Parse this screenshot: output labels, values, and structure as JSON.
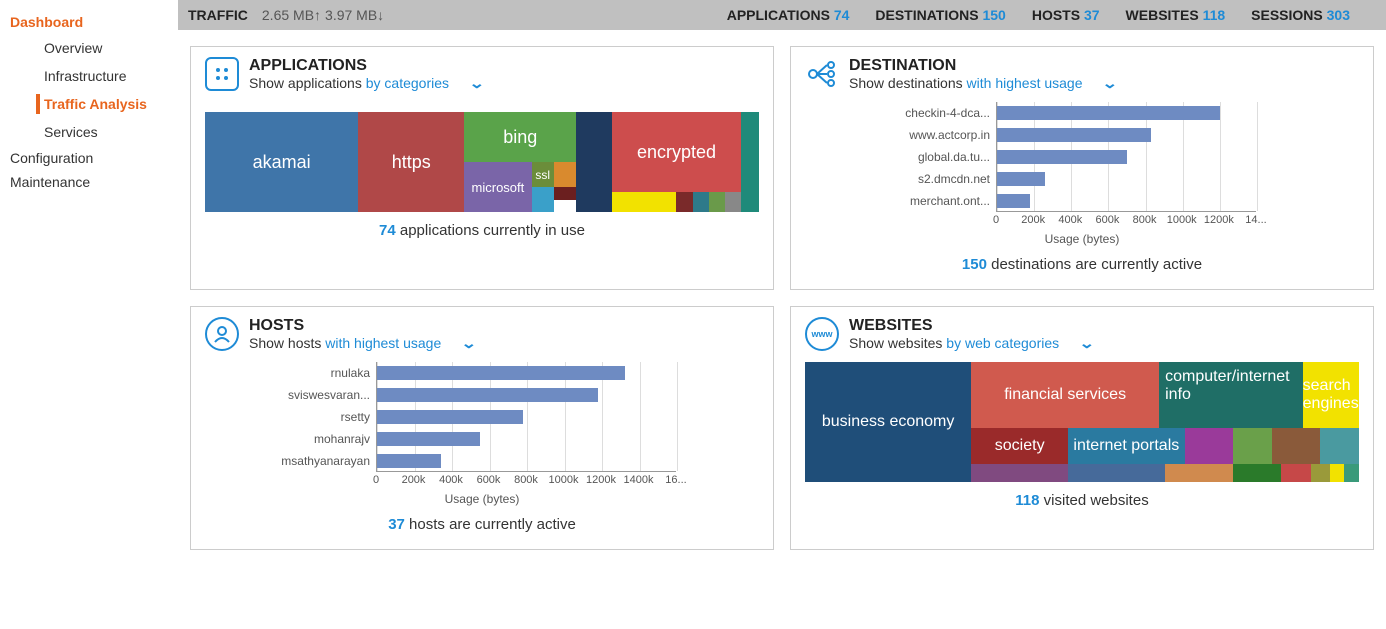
{
  "sidebar": {
    "dashboard": "Dashboard",
    "items": [
      {
        "label": "Overview"
      },
      {
        "label": "Infrastructure"
      },
      {
        "label": "Traffic Analysis"
      },
      {
        "label": "Services"
      }
    ],
    "configuration": "Configuration",
    "maintenance": "Maintenance"
  },
  "topbar": {
    "traffic_label": "TRAFFIC",
    "up": "2.65 MB",
    "down": "3.97 MB",
    "stats": [
      {
        "label": "APPLICATIONS",
        "value": "74"
      },
      {
        "label": "DESTINATIONS",
        "value": "150"
      },
      {
        "label": "HOSTS",
        "value": "37"
      },
      {
        "label": "WEBSITES",
        "value": "118"
      },
      {
        "label": "SESSIONS",
        "value": "303"
      }
    ]
  },
  "panels": {
    "apps": {
      "title": "APPLICATIONS",
      "sub_prefix": "Show applications ",
      "sub_link": "by categories",
      "footer_num": "74",
      "footer_rest": " applications currently in use",
      "treemap": [
        {
          "label": "akamai",
          "flex": 26,
          "color": "#3f75a9"
        },
        {
          "label": "https",
          "flex": 18,
          "color": "#b04848"
        },
        {
          "label": "bing",
          "color": "#5aa34a"
        },
        {
          "label": "microsoft",
          "color": "#7a65a8"
        },
        {
          "label": "ssl",
          "color": "#6b8d3a"
        },
        {
          "label": "encrypted",
          "color": "#cd4d4d"
        }
      ]
    },
    "dest": {
      "title": "DESTINATION",
      "sub_prefix": "Show destinations ",
      "sub_link": "with highest usage",
      "footer_num": "150",
      "footer_rest": " destinations are currently active",
      "axis_label": "Usage (bytes)"
    },
    "hosts": {
      "title": "HOSTS",
      "sub_prefix": "Show hosts ",
      "sub_link": "with highest usage",
      "footer_num": "37",
      "footer_rest": " hosts are currently active",
      "axis_label": "Usage (bytes)"
    },
    "web": {
      "title": "WEBSITES",
      "sub_prefix": "Show websites ",
      "sub_link": "by web categories",
      "footer_num": "118",
      "footer_rest": " visited websites"
    }
  },
  "chart_data": [
    {
      "type": "bar",
      "orientation": "horizontal",
      "title": "Destinations with highest usage",
      "xlabel": "Usage (bytes)",
      "xlim": [
        0,
        1400000
      ],
      "ticks": [
        0,
        200000,
        400000,
        600000,
        800000,
        1000000,
        1200000,
        1400000
      ],
      "tick_labels": [
        "0",
        "200k",
        "400k",
        "600k",
        "800k",
        "1000k",
        "1200k",
        "14..."
      ],
      "categories": [
        "checkin-4-dca...",
        "www.actcorp.in",
        "global.da.tu...",
        "s2.dmcdn.net",
        "merchant.ont..."
      ],
      "values": [
        1200000,
        830000,
        700000,
        260000,
        180000
      ]
    },
    {
      "type": "bar",
      "orientation": "horizontal",
      "title": "Hosts with highest usage",
      "xlabel": "Usage (bytes)",
      "xlim": [
        0,
        1600000
      ],
      "ticks": [
        0,
        200000,
        400000,
        600000,
        800000,
        1000000,
        1200000,
        1400000,
        1600000
      ],
      "tick_labels": [
        "0",
        "200k",
        "400k",
        "600k",
        "800k",
        "1000k",
        "1200k",
        "1400k",
        "16..."
      ],
      "categories": [
        "rnulaka",
        "sviswesvaran...",
        "rsetty",
        "mohanrajv",
        "msathyanarayan"
      ],
      "values": [
        1320000,
        1180000,
        780000,
        550000,
        340000
      ]
    },
    {
      "type": "treemap",
      "title": "Applications by categories",
      "items": [
        "akamai",
        "https",
        "bing",
        "microsoft",
        "ssl",
        "encrypted"
      ]
    },
    {
      "type": "treemap",
      "title": "Websites by web categories",
      "items": [
        "business economy",
        "financial services",
        "computer/internet info",
        "search engines",
        "society",
        "internet portals"
      ]
    }
  ]
}
